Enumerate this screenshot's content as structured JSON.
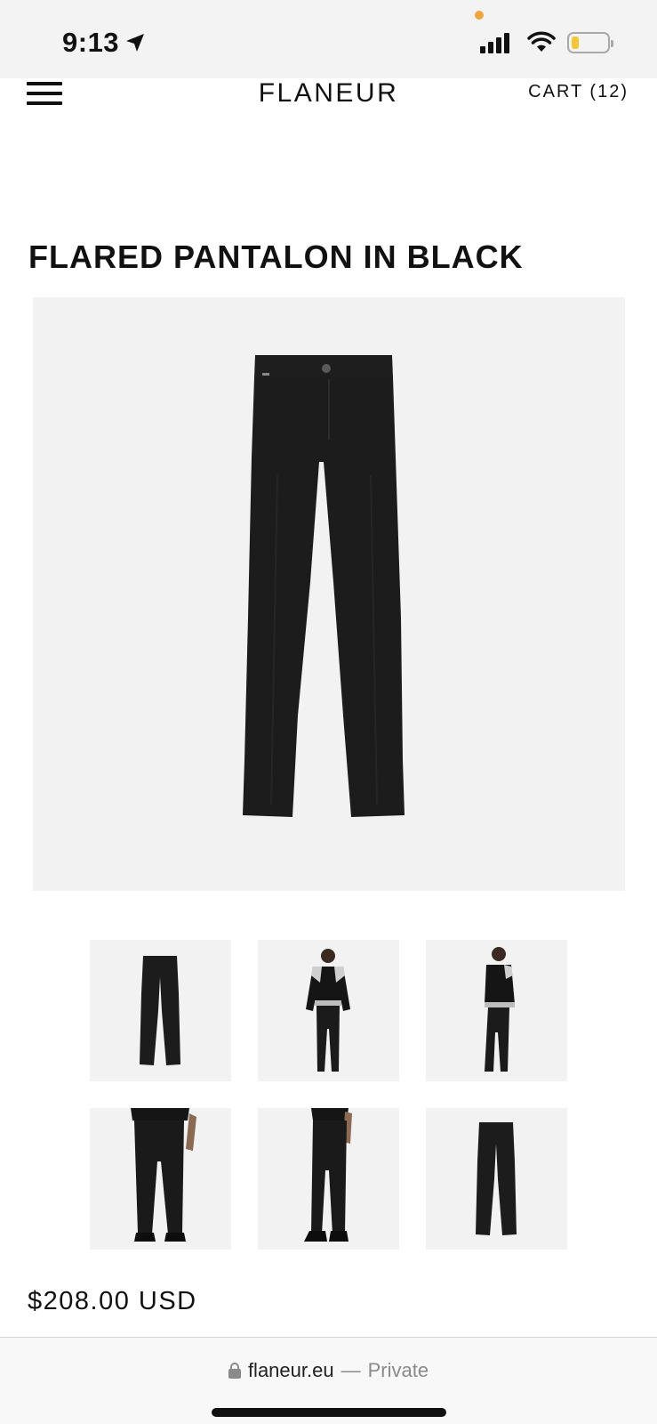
{
  "status_bar": {
    "time": "9:13",
    "location_icon": "location-arrow-icon",
    "privacy_dot_color": "#f0a640",
    "signal_icon": "cellular-signal-icon",
    "wifi_icon": "wifi-icon",
    "battery_icon": "battery-icon",
    "battery_level": 0.2,
    "battery_color": "#f2c838"
  },
  "header": {
    "menu_icon": "hamburger-menu-icon",
    "logo": "FLANEUR",
    "cart_label": "CART (12)"
  },
  "product": {
    "title": "FLARED PANTALON IN BLACK",
    "price": "$208.00 USD",
    "main_image": "black-flared-trousers-flat-front",
    "thumbnails": [
      "trousers-flat-front",
      "model-front-varsity-jacket",
      "model-side-varsity-jacket",
      "model-front-closeup-legs",
      "model-side-closeup-legs",
      "trousers-flat-back"
    ]
  },
  "browser": {
    "lock_icon": "lock-icon",
    "domain": "flaneur.eu",
    "separator": "—",
    "mode": "Private"
  },
  "colors": {
    "image_bg": "#f2f2f2",
    "garment": "#1c1c1c",
    "text": "#111111"
  }
}
